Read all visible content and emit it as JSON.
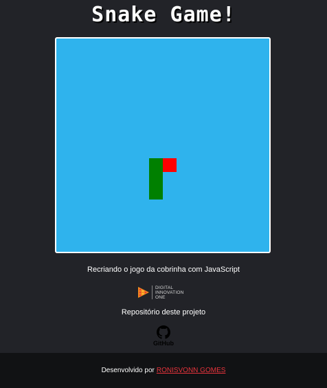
{
  "header": {
    "title": "Snake Game!"
  },
  "game": {
    "snake_color": "#008000",
    "food_color": "#ff0000",
    "board_color": "#2fb3ed"
  },
  "info": {
    "subtitle": "Recriando o jogo da cobrinha com JavaScript",
    "dio_lines": [
      "DIGITAL",
      "INNOVATION",
      "ONE"
    ],
    "repo_label": "Repositório deste projeto",
    "github_label": "GitHub",
    "github_icon": "github-icon"
  },
  "footer": {
    "prefix": "Desenvolvido por",
    "author": "RONISVONN GOMES",
    "link_color": "#e8343c"
  }
}
